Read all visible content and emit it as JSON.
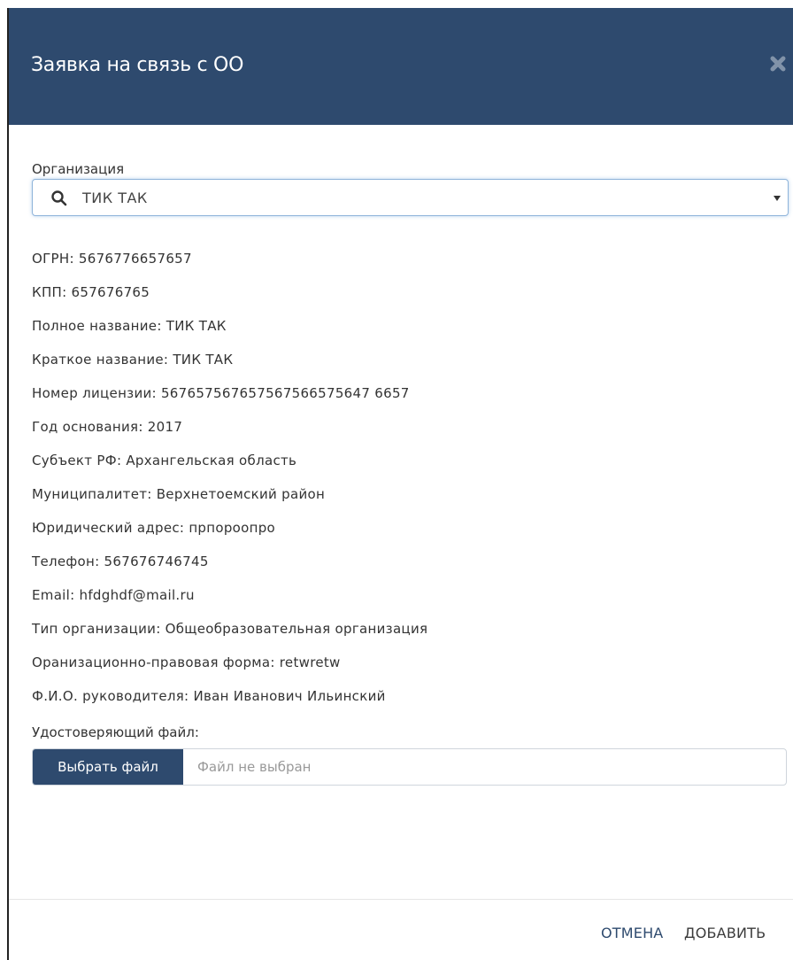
{
  "modal": {
    "title": "Заявка на связь с ОО"
  },
  "organization": {
    "label": "Организация",
    "search_value": "ТИК ТАК"
  },
  "info": [
    "ОГРН: 5676776657657",
    "КПП: 657676765",
    "Полное название: ТИК ТАК",
    "Краткое название: ТИК ТАК",
    "Номер лицензии: 567657567657567566575647 6657",
    "Год основания: 2017",
    "Субъект РФ: Архангельская область",
    "Муниципалитет: Верхнетоемский район",
    "Юридический адрес: прпороопро",
    "Телефон: 567676746745",
    "Email: hfdghdf@mail.ru",
    "Тип организации: Общеобразовательная организация",
    "Оранизационно-правовая форма: retwretw",
    "Ф.И.О. руководителя: Иван Иванович Ильинский"
  ],
  "file": {
    "label": "Удостоверяющий файл:",
    "button_label": "Выбрать файл",
    "status": "Файл не выбран"
  },
  "footer": {
    "cancel_label": "ОТМЕНА",
    "add_label": "ДОБАВИТЬ"
  },
  "colors": {
    "header": "#2e4a6e",
    "accent": "#2e4a6e"
  },
  "icons": {
    "close": "close-icon",
    "search": "search-icon",
    "dropdown": "chevron-down-icon"
  }
}
